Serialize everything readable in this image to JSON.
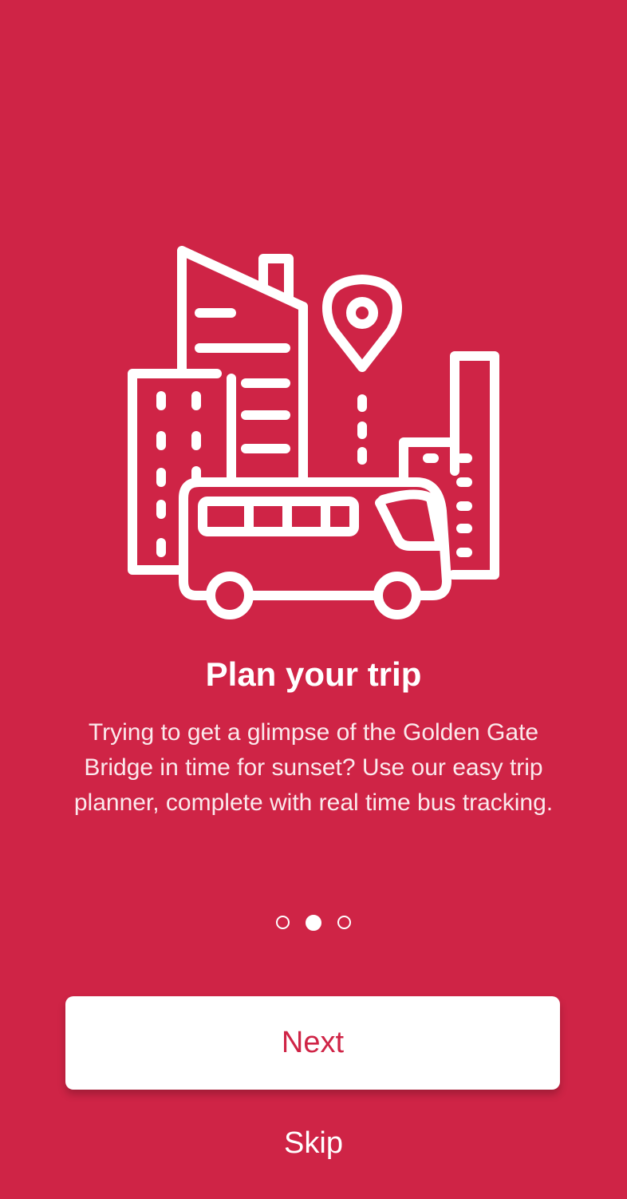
{
  "colors": {
    "background": "#cf2446",
    "foreground": "#ffffff",
    "button_text": "#cf2446"
  },
  "illustration": {
    "icon": "city-bus-location-icon"
  },
  "onboarding": {
    "title": "Plan your trip",
    "description": "Trying to get a glimpse of the Golden Gate Bridge in time for sunset? Use our easy trip planner, complete with real time bus tracking.",
    "page_indicator": {
      "total": 3,
      "current": 2
    }
  },
  "actions": {
    "next_label": "Next",
    "skip_label": "Skip"
  }
}
